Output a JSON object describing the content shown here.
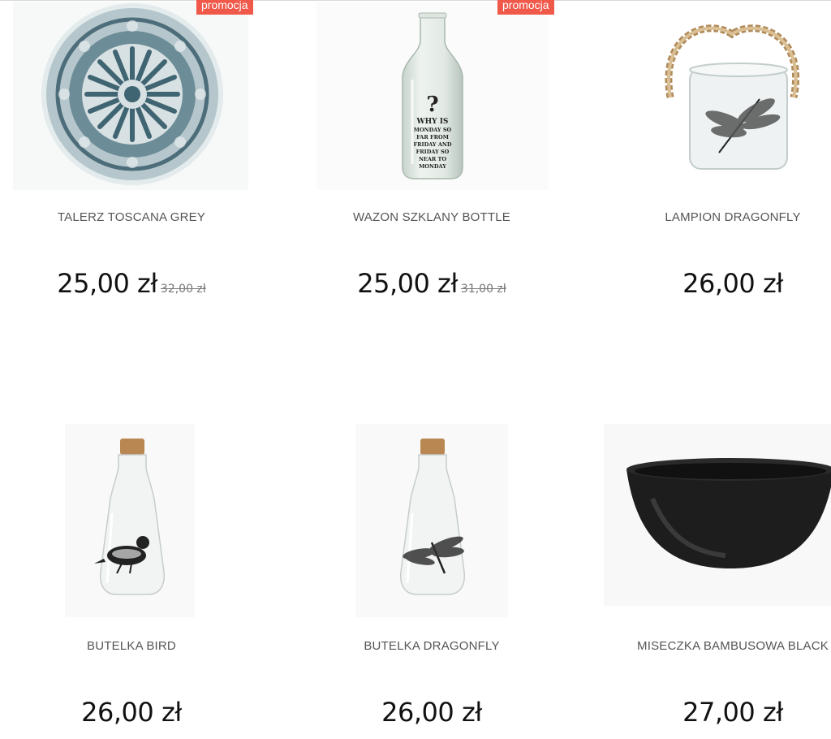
{
  "products": [
    {
      "name": "TALERZ TOSCANA GREY",
      "price": "25,00 zł",
      "old_price": "32,00 zł",
      "badge": "promocja",
      "image": "plate-image"
    },
    {
      "name": "WAZON SZKLANY BOTTLE",
      "price": "25,00 zł",
      "old_price": "31,00 zł",
      "badge": "promocja",
      "image": "vase-image",
      "vase_text": [
        "?",
        "WHY IS",
        "MONDAY SO",
        "FAR FROM",
        "FRIDAY AND",
        "FRIDAY SO",
        "NEAR TO",
        "MONDAY"
      ]
    },
    {
      "name": "LAMPION DRAGONFLY",
      "price": "26,00 zł",
      "image": "lantern-image"
    },
    {
      "name": "BUTELKA BIRD",
      "price": "26,00 zł",
      "image": "bottle-bird-image"
    },
    {
      "name": "BUTELKA DRAGONFLY",
      "price": "26,00 zł",
      "image": "bottle-dragonfly-image"
    },
    {
      "name": "MISECZKA BAMBUSOWA BLACK",
      "price": "27,00 zł",
      "image": "bowl-image"
    }
  ]
}
